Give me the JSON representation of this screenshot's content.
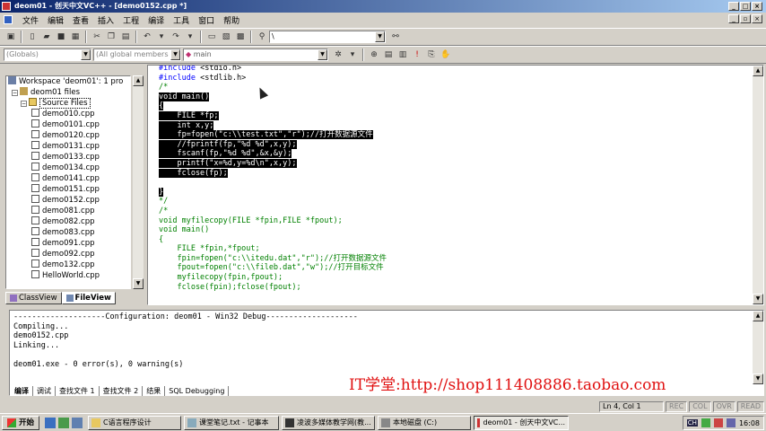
{
  "window": {
    "title": "deom01 - 创天中文VC++ - [demo0152.cpp *]"
  },
  "menu": [
    "文件",
    "编辑",
    "查看",
    "插入",
    "工程",
    "编译",
    "工具",
    "窗口",
    "帮助"
  ],
  "toolbar": {
    "find_value": "\\",
    "scope_combo": "(Globals)",
    "members_combo": "(All global members",
    "function_combo": "main"
  },
  "workspace": {
    "root": "Workspace 'deom01': 1 pro",
    "project": "deom01 files",
    "folder": "Source Files",
    "files": [
      "demo010.cpp",
      "demo0101.cpp",
      "demo0120.cpp",
      "demo0131.cpp",
      "demo0133.cpp",
      "demo0134.cpp",
      "demo0141.cpp",
      "demo0151.cpp",
      "demo0152.cpp",
      "demo081.cpp",
      "demo082.cpp",
      "demo083.cpp",
      "demo091.cpp",
      "demo092.cpp",
      "demo132.cpp",
      "HelloWorld.cpp"
    ],
    "tabs": [
      "ClassView",
      "FileView"
    ]
  },
  "code_lines": [
    "#include <stdio.h>",
    "#include <stdlib.h>",
    "/*",
    "void main()",
    "{",
    "    FILE *fp;",
    "    int x,y;",
    "    fp=fopen(\"c:\\\\test.txt\",\"r\");//打开数据源文件",
    "    //fprintf(fp,\"%d %d\",x,y);",
    "    fscanf(fp,\"%d %d\",&x,&y);",
    "    printf(\"x=%d,y=%d\\n\",x,y);",
    "    fclose(fp);",
    "",
    "}",
    "*/",
    "/*",
    "void myfilecopy(FILE *fpin,FILE *fpout);",
    "void main()",
    "{",
    "    FILE *fpin,*fpout;",
    "    fpin=fopen(\"c:\\\\itedu.dat\",\"r\");//打开数据源文件",
    "    fpout=fopen(\"c:\\\\fileb.dat\",\"w\");//打开目标文件",
    "    myfilecopy(fpin,fpout);",
    "    fclose(fpin);fclose(fpout);"
  ],
  "output": {
    "lines": [
      "--------------------Configuration: deom01 - Win32 Debug--------------------",
      "Compiling...",
      "demo0152.cpp",
      "Linking...",
      "",
      "deom01.exe - 0 error(s), 0 warning(s)"
    ],
    "watermark": "IT学堂:http://shop111408886.taobao.com",
    "tabs": [
      "编译",
      "调试",
      "查找文件 1",
      "查找文件 2",
      "结果",
      "SQL Debugging"
    ]
  },
  "status": {
    "position": "Ln 4, Col 1",
    "rec": "REC",
    "col": "COL",
    "ovr": "OVR",
    "read": "READ"
  },
  "taskbar": {
    "start": "开始",
    "tasks": [
      "C语言程序设计",
      "课堂笔记.txt - 记事本",
      "凌波多媒体教学网(教...",
      "本地磁盘 (C:)",
      "deom01 - 创天中文VC..."
    ],
    "clock": "16:08",
    "ime": "CH"
  },
  "colors": {
    "title_start": "#0a246a",
    "title_end": "#a6caf0",
    "keyword": "#0000ff",
    "comment": "#008000",
    "watermark": "#e01010"
  }
}
